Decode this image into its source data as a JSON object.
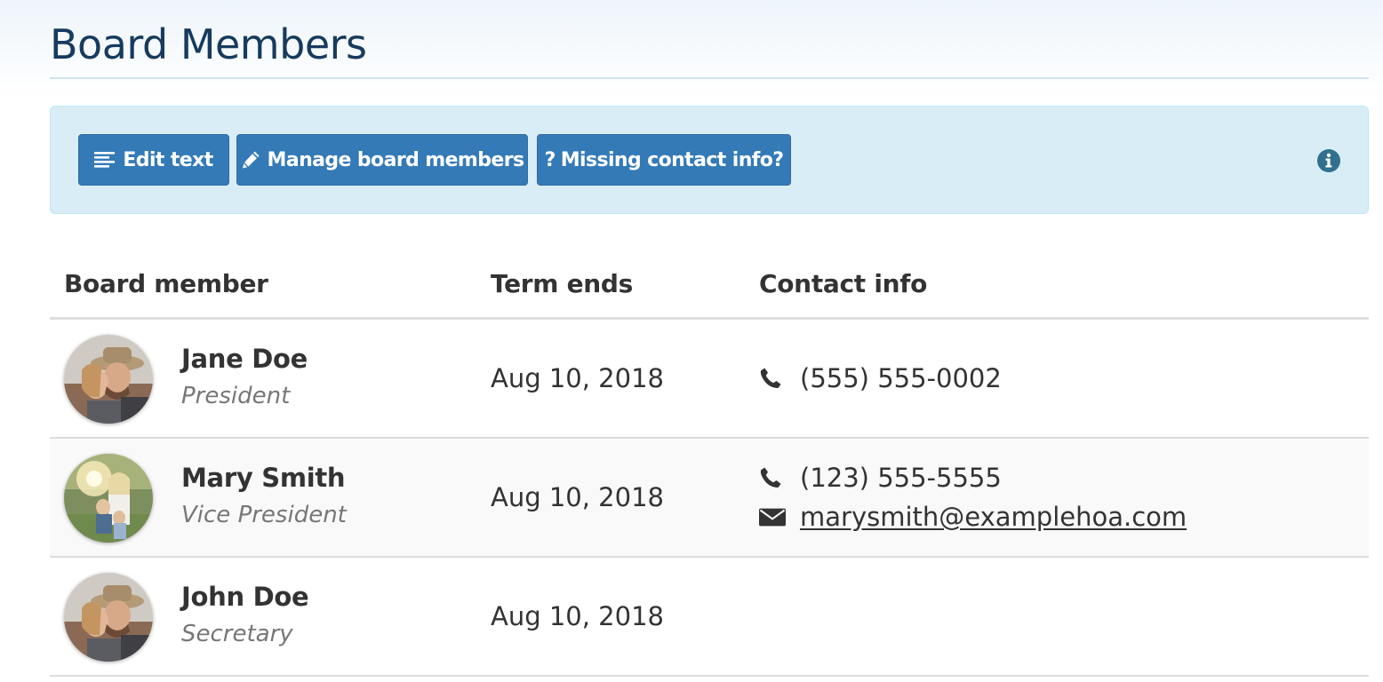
{
  "page": {
    "title": "Board Members"
  },
  "toolbar": {
    "edit_text_label": "Edit text",
    "manage_members_label": "Manage board members",
    "missing_contact_label": "Missing contact info?",
    "edit_icon": "align-left-icon",
    "manage_icon": "pencil-icon",
    "missing_icon": "question-icon",
    "info_icon": "info-circle-icon"
  },
  "table": {
    "headers": {
      "member": "Board member",
      "term": "Term ends",
      "contact": "Contact info"
    },
    "rows": [
      {
        "name": "Jane Doe",
        "role": "President",
        "term_ends": "Aug 10, 2018",
        "phone": "(555) 555-0002",
        "email": null,
        "avatar": "avatar-couple-photo"
      },
      {
        "name": "Mary Smith",
        "role": "Vice President",
        "term_ends": "Aug 10, 2018",
        "phone": "(123) 555-5555",
        "email": "marysmith@examplehoa.com",
        "avatar": "avatar-family-photo"
      },
      {
        "name": "John Doe",
        "role": "Secretary",
        "term_ends": "Aug 10, 2018",
        "phone": null,
        "email": null,
        "avatar": "avatar-couple-photo"
      }
    ]
  },
  "colors": {
    "title": "#163b5e",
    "toolbar_bg": "#d9edf7",
    "button_bg": "#337ab7",
    "info_icon": "#31708f",
    "muted_text": "#777777"
  }
}
